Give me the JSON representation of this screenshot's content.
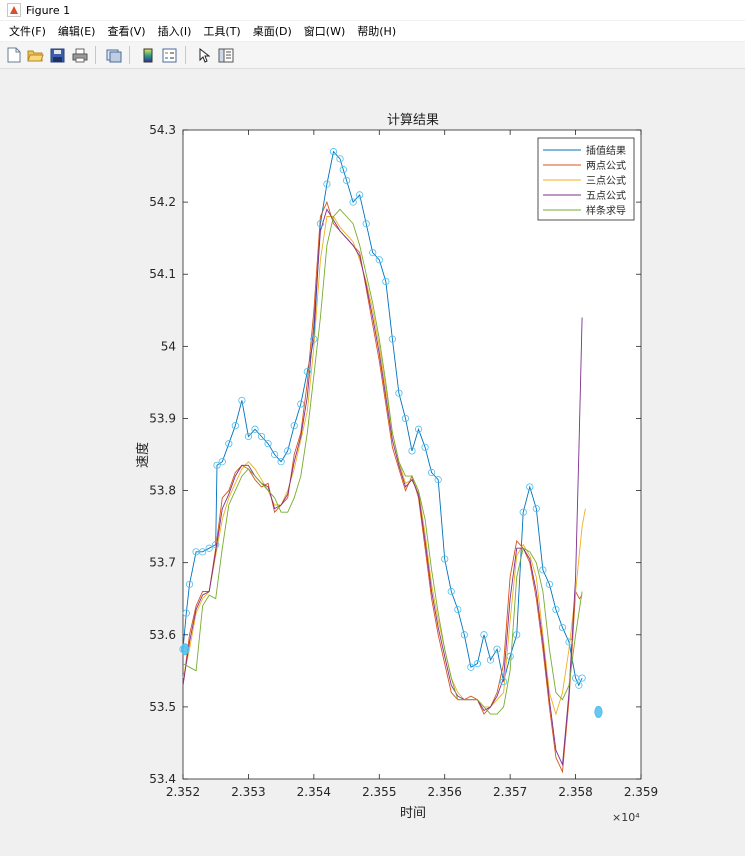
{
  "window": {
    "title": "Figure 1"
  },
  "menu": [
    {
      "id": "file",
      "label": "文件(F)"
    },
    {
      "id": "edit",
      "label": "编辑(E)"
    },
    {
      "id": "view",
      "label": "查看(V)"
    },
    {
      "id": "insert",
      "label": "插入(I)"
    },
    {
      "id": "tools",
      "label": "工具(T)"
    },
    {
      "id": "desktop",
      "label": "桌面(D)"
    },
    {
      "id": "window",
      "label": "窗口(W)"
    },
    {
      "id": "help",
      "label": "帮助(H)"
    }
  ],
  "toolbar": [
    {
      "name": "new-figure-icon"
    },
    {
      "name": "open-folder-icon"
    },
    {
      "name": "save-icon"
    },
    {
      "name": "print-icon"
    },
    {
      "name": "link-plot-icon"
    },
    {
      "name": "colorbar-icon"
    },
    {
      "name": "legend-icon"
    },
    {
      "name": "pointer-icon"
    },
    {
      "name": "property-editor-icon"
    }
  ],
  "colors": {
    "interp": "#0072bd",
    "two_point": "#d95319",
    "three_point": "#edb120",
    "five_point": "#7e2f8e",
    "spline": "#77ac30",
    "marker": "#4dbeee"
  },
  "chart_data": {
    "type": "line",
    "title": "计算结果",
    "xlabel": "时间",
    "ylabel": "速度",
    "x_exponent": "×10⁴",
    "xlim": [
      2.352,
      2.359
    ],
    "ylim": [
      53.4,
      54.3
    ],
    "xticks": [
      "2.352",
      "2.353",
      "2.354",
      "2.355",
      "2.356",
      "2.357",
      "2.358",
      "2.359"
    ],
    "yticks": [
      "53.4",
      "53.5",
      "53.6",
      "53.7",
      "53.8",
      "53.9",
      "54",
      "54.1",
      "54.2",
      "54.3"
    ],
    "grid": false,
    "legend_position": "top-right",
    "series": [
      {
        "name": "插值结果",
        "color": "#0072bd",
        "marker": "circle",
        "x": [
          2.352,
          2.35205,
          2.3521,
          2.3522,
          2.3523,
          2.3524,
          2.3525,
          2.35252,
          2.3526,
          2.3527,
          2.3528,
          2.3529,
          2.353,
          2.3531,
          2.3532,
          2.3533,
          2.3534,
          2.3535,
          2.3536,
          2.3537,
          2.3538,
          2.3539,
          2.354,
          2.3541,
          2.3542,
          2.3543,
          2.3544,
          2.35445,
          2.3545,
          2.3546,
          2.3547,
          2.3548,
          2.3549,
          2.355,
          2.3551,
          2.3552,
          2.3553,
          2.3554,
          2.3555,
          2.3556,
          2.3557,
          2.3558,
          2.3559,
          2.356,
          2.3561,
          2.3562,
          2.3563,
          2.3564,
          2.3565,
          2.3566,
          2.3567,
          2.3568,
          2.3569,
          2.357,
          2.3571,
          2.3572,
          2.3573,
          2.3574,
          2.3575,
          2.3576,
          2.3577,
          2.3578,
          2.3579,
          2.358,
          2.35805,
          2.3581
        ],
        "y": [
          53.58,
          53.63,
          53.67,
          53.715,
          53.715,
          53.72,
          53.725,
          53.835,
          53.84,
          53.865,
          53.89,
          53.925,
          53.875,
          53.885,
          53.875,
          53.865,
          53.85,
          53.84,
          53.855,
          53.89,
          53.92,
          53.965,
          54.01,
          54.17,
          54.225,
          54.27,
          54.26,
          54.245,
          54.23,
          54.2,
          54.21,
          54.17,
          54.13,
          54.12,
          54.09,
          54.01,
          53.935,
          53.9,
          53.855,
          53.885,
          53.86,
          53.825,
          53.815,
          53.705,
          53.66,
          53.635,
          53.6,
          53.555,
          53.56,
          53.6,
          53.565,
          53.58,
          53.535,
          53.57,
          53.6,
          53.77,
          53.805,
          53.775,
          53.69,
          53.67,
          53.635,
          53.61,
          53.59,
          53.54,
          53.53,
          53.54
        ]
      },
      {
        "name": "两点公式",
        "color": "#d95319",
        "x": [
          2.352,
          2.3521,
          2.3522,
          2.3523,
          2.3524,
          2.3525,
          2.3526,
          2.3527,
          2.3528,
          2.3529,
          2.353,
          2.3531,
          2.3532,
          2.3533,
          2.3534,
          2.3535,
          2.3536,
          2.3537,
          2.3538,
          2.3539,
          2.354,
          2.3541,
          2.3542,
          2.3543,
          2.3544,
          2.3545,
          2.3546,
          2.3547,
          2.3548,
          2.3549,
          2.355,
          2.3551,
          2.3552,
          2.3553,
          2.3554,
          2.3555,
          2.3556,
          2.3557,
          2.3558,
          2.3559,
          2.356,
          2.3561,
          2.3562,
          2.3563,
          2.3564,
          2.3565,
          2.3566,
          2.3567,
          2.3568,
          2.3569,
          2.357,
          2.3571,
          2.3572,
          2.3573,
          2.3574,
          2.3575,
          2.3576,
          2.3577,
          2.3578,
          2.3579,
          2.358,
          2.35803,
          2.35806,
          2.3581
        ],
        "y": [
          53.53,
          53.6,
          53.64,
          53.66,
          53.66,
          53.72,
          53.79,
          53.8,
          53.825,
          53.835,
          53.83,
          53.815,
          53.805,
          53.81,
          53.77,
          53.78,
          53.79,
          53.85,
          53.88,
          53.95,
          54.05,
          54.18,
          54.2,
          54.17,
          54.16,
          54.15,
          54.14,
          54.13,
          54.08,
          54.03,
          53.98,
          53.92,
          53.86,
          53.83,
          53.8,
          53.82,
          53.79,
          53.72,
          53.65,
          53.6,
          53.56,
          53.52,
          53.51,
          53.51,
          53.515,
          53.51,
          53.49,
          53.5,
          53.52,
          53.56,
          53.68,
          53.73,
          53.72,
          53.7,
          53.65,
          53.58,
          53.5,
          53.43,
          53.41,
          53.51,
          53.66,
          53.655,
          53.65,
          53.655
        ]
      },
      {
        "name": "三点公式",
        "color": "#edb120",
        "x": [
          2.352,
          2.3521,
          2.3522,
          2.3523,
          2.3524,
          2.3525,
          2.3526,
          2.3527,
          2.3528,
          2.3529,
          2.353,
          2.3531,
          2.3532,
          2.3533,
          2.3534,
          2.3535,
          2.3536,
          2.3537,
          2.3538,
          2.3539,
          2.354,
          2.3541,
          2.3542,
          2.3543,
          2.3544,
          2.3545,
          2.3546,
          2.3547,
          2.3548,
          2.3549,
          2.355,
          2.3551,
          2.3552,
          2.3553,
          2.3554,
          2.3555,
          2.3556,
          2.3557,
          2.3558,
          2.3559,
          2.356,
          2.3561,
          2.3562,
          2.3563,
          2.3564,
          2.3565,
          2.3566,
          2.3567,
          2.3568,
          2.3569,
          2.357,
          2.3571,
          2.3572,
          2.3573,
          2.3574,
          2.3575,
          2.3576,
          2.3577,
          2.3578,
          2.3579,
          2.358,
          2.3581,
          2.35815
        ],
        "y": [
          53.54,
          53.58,
          53.63,
          53.65,
          53.66,
          53.71,
          53.76,
          53.79,
          53.81,
          53.83,
          53.84,
          53.83,
          53.815,
          53.8,
          53.78,
          53.78,
          53.8,
          53.83,
          53.87,
          53.91,
          54.0,
          54.12,
          54.18,
          54.18,
          54.165,
          54.155,
          54.145,
          54.12,
          54.09,
          54.05,
          54.0,
          53.94,
          53.88,
          53.84,
          53.81,
          53.815,
          53.8,
          53.74,
          53.67,
          53.62,
          53.58,
          53.54,
          53.52,
          53.51,
          53.51,
          53.51,
          53.5,
          53.5,
          53.51,
          53.52,
          53.62,
          53.71,
          53.725,
          53.71,
          53.68,
          53.6,
          53.52,
          53.49,
          53.52,
          53.58,
          53.66,
          53.75,
          53.775
        ]
      },
      {
        "name": "五点公式",
        "color": "#7e2f8e",
        "x": [
          2.352,
          2.3521,
          2.3522,
          2.3523,
          2.3524,
          2.3525,
          2.3526,
          2.3527,
          2.3528,
          2.3529,
          2.353,
          2.3531,
          2.3532,
          2.3533,
          2.3534,
          2.3535,
          2.3536,
          2.3537,
          2.3538,
          2.3539,
          2.354,
          2.3541,
          2.3542,
          2.3543,
          2.3544,
          2.3545,
          2.3546,
          2.3547,
          2.3548,
          2.3549,
          2.355,
          2.3551,
          2.3552,
          2.3553,
          2.3554,
          2.3555,
          2.3556,
          2.3557,
          2.3558,
          2.3559,
          2.356,
          2.3561,
          2.3562,
          2.3563,
          2.3564,
          2.3565,
          2.3566,
          2.3567,
          2.3568,
          2.3569,
          2.357,
          2.3571,
          2.3572,
          2.3573,
          2.3574,
          2.3575,
          2.3576,
          2.3577,
          2.3578,
          2.3579,
          2.358,
          2.35805,
          2.3581
        ],
        "y": [
          53.53,
          53.59,
          53.635,
          53.655,
          53.66,
          53.715,
          53.775,
          53.795,
          53.82,
          53.835,
          53.835,
          53.82,
          53.81,
          53.805,
          53.775,
          53.78,
          53.795,
          53.84,
          53.875,
          53.93,
          54.03,
          54.16,
          54.19,
          54.175,
          54.16,
          54.15,
          54.14,
          54.125,
          54.085,
          54.04,
          53.99,
          53.93,
          53.87,
          53.835,
          53.805,
          53.815,
          53.795,
          53.73,
          53.66,
          53.61,
          53.57,
          53.53,
          53.515,
          53.51,
          53.51,
          53.51,
          53.495,
          53.5,
          53.515,
          53.54,
          53.65,
          53.72,
          53.72,
          53.705,
          53.66,
          53.59,
          53.51,
          53.44,
          53.42,
          53.52,
          53.68,
          53.85,
          54.04
        ]
      },
      {
        "name": "样条求导",
        "color": "#77ac30",
        "x": [
          2.352,
          2.3521,
          2.3522,
          2.3523,
          2.3524,
          2.3525,
          2.3526,
          2.3527,
          2.3528,
          2.3529,
          2.353,
          2.3531,
          2.3532,
          2.3533,
          2.3534,
          2.3535,
          2.3536,
          2.3537,
          2.3538,
          2.3539,
          2.354,
          2.3541,
          2.3542,
          2.3543,
          2.3544,
          2.3545,
          2.3546,
          2.3547,
          2.3548,
          2.3549,
          2.355,
          2.3551,
          2.3552,
          2.3553,
          2.3554,
          2.3555,
          2.3556,
          2.3557,
          2.3558,
          2.3559,
          2.356,
          2.3561,
          2.3562,
          2.3563,
          2.3564,
          2.3565,
          2.3566,
          2.3567,
          2.3568,
          2.3569,
          2.357,
          2.3571,
          2.3572,
          2.3573,
          2.3574,
          2.3575,
          2.3576,
          2.3577,
          2.3578,
          2.3579,
          2.358,
          2.3581
        ],
        "y": [
          53.56,
          53.555,
          53.55,
          53.64,
          53.655,
          53.65,
          53.72,
          53.78,
          53.8,
          53.82,
          53.83,
          53.82,
          53.81,
          53.8,
          53.79,
          53.77,
          53.77,
          53.79,
          53.82,
          53.88,
          53.96,
          54.04,
          54.14,
          54.18,
          54.19,
          54.18,
          54.17,
          54.14,
          54.1,
          54.06,
          54.01,
          53.95,
          53.88,
          53.84,
          53.82,
          53.82,
          53.8,
          53.76,
          53.69,
          53.63,
          53.58,
          53.54,
          53.51,
          53.51,
          53.51,
          53.51,
          53.5,
          53.49,
          53.49,
          53.5,
          53.55,
          53.68,
          53.72,
          53.715,
          53.7,
          53.66,
          53.58,
          53.52,
          53.51,
          53.53,
          53.6,
          53.66
        ]
      }
    ],
    "extra_markers": [
      {
        "x": 2.35203,
        "y": 53.58
      },
      {
        "x": 2.35835,
        "y": 53.493
      }
    ]
  }
}
